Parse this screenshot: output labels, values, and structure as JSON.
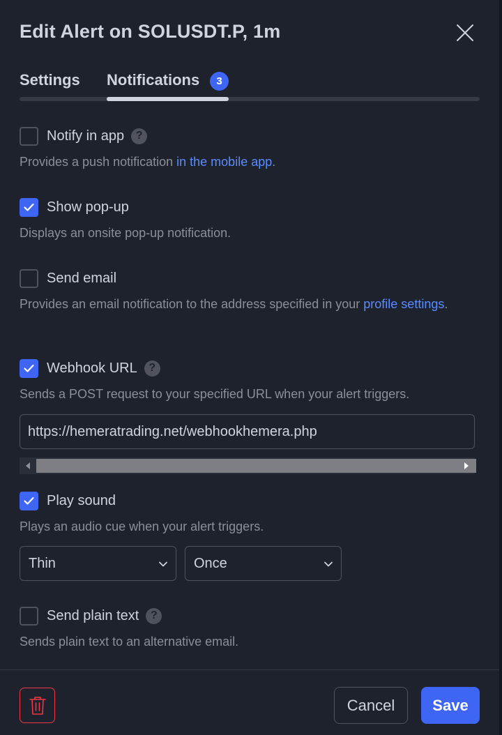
{
  "dialog": {
    "title": "Edit Alert on SOLUSDT.P, 1m",
    "close_icon": "close-icon"
  },
  "tabs": [
    {
      "label": "Settings",
      "active": false
    },
    {
      "label": "Notifications",
      "active": true,
      "badge": "3"
    }
  ],
  "options": {
    "notify_app": {
      "label": "Notify in app",
      "checked": false,
      "help": "?",
      "desc_prefix": "Provides a push notification ",
      "desc_link": "in the mobile app",
      "desc_suffix": "."
    },
    "popup": {
      "label": "Show pop-up",
      "checked": true,
      "desc": "Displays an onsite pop-up notification."
    },
    "email": {
      "label": "Send email",
      "checked": false,
      "desc_prefix": "Provides an email notification to the address specified in your ",
      "desc_link": "profile settings",
      "desc_suffix": "."
    },
    "webhook": {
      "label": "Webhook URL",
      "checked": true,
      "help": "?",
      "desc": "Sends a POST request to your specified URL when your alert triggers.",
      "url_value": "https://hemeratrading.net/webhookhemera.php"
    },
    "sound": {
      "label": "Play sound",
      "checked": true,
      "desc": "Plays an audio cue when your alert triggers.",
      "sound_select": "Thin",
      "repeat_select": "Once"
    },
    "plain_text": {
      "label": "Send plain text",
      "checked": false,
      "help": "?",
      "desc": "Sends plain text to an alternative email."
    }
  },
  "footer": {
    "delete_icon": "trash-icon",
    "cancel_label": "Cancel",
    "save_label": "Save"
  },
  "colors": {
    "background": "#1e222d",
    "accent": "#3f65f5",
    "link": "#5b8cff",
    "danger": "#f23645",
    "text": "#d1d4dc",
    "muted": "#8c8f98"
  }
}
